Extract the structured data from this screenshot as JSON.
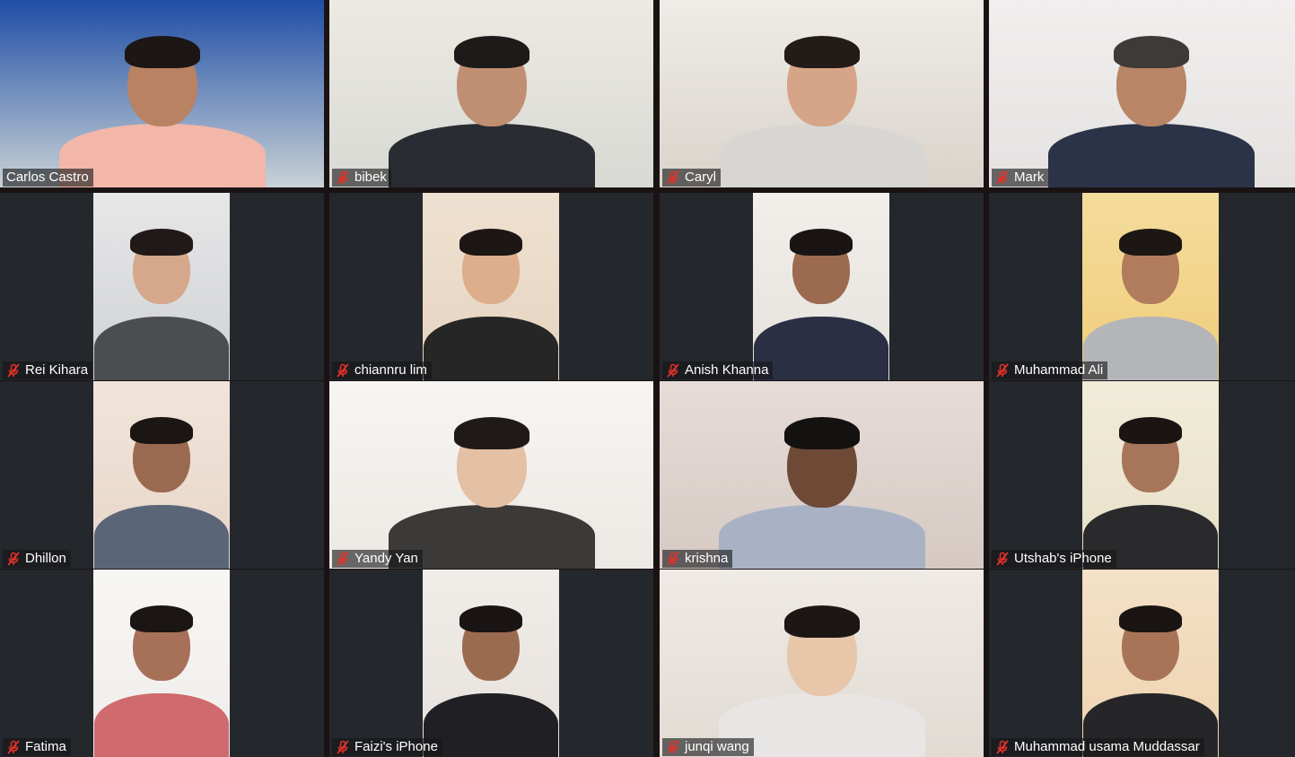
{
  "meeting": {
    "view": "gallery",
    "participants": [
      {
        "name": "Carlos Castro",
        "muted": false,
        "active_speaker": true,
        "video": {
          "layout": "full",
          "bg": "#c9d2d6",
          "wall": "#1f4ea6",
          "skin": "#b98262",
          "hair": "#1c1614",
          "shirt": "#f2b7a8"
        }
      },
      {
        "name": "bibek",
        "muted": true,
        "active_speaker": false,
        "video": {
          "layout": "full",
          "bg": "#d8d9d4",
          "wall": "#eceae2",
          "skin": "#c08f72",
          "hair": "#1d1a1a",
          "shirt": "#2a2c33"
        }
      },
      {
        "name": "Caryl",
        "muted": true,
        "active_speaker": false,
        "video": {
          "layout": "full",
          "bg": "#d9d3cb",
          "wall": "#efece7",
          "skin": "#d6a486",
          "hair": "#231b17",
          "shirt": "#d8d6d2"
        }
      },
      {
        "name": "Mark",
        "muted": true,
        "active_speaker": false,
        "video": {
          "layout": "full",
          "bg": "#e4e2e1",
          "wall": "#f1efee",
          "skin": "#b88566",
          "hair": "#3d3a38",
          "shirt": "#2b3348"
        }
      },
      {
        "name": "Rei Kihara",
        "muted": true,
        "active_speaker": false,
        "video": {
          "layout": "portrait",
          "bg": "#cfd1d4",
          "wall": "#e7e7e8",
          "skin": "#d5a88c",
          "hair": "#201917",
          "shirt": "#4c4d50"
        }
      },
      {
        "name": "chiannru lim",
        "muted": true,
        "active_speaker": false,
        "video": {
          "layout": "portrait",
          "bg": "#e6d3bf",
          "wall": "#efe1d1",
          "skin": "#dcae8c",
          "hair": "#1c1614",
          "shirt": "#262626"
        }
      },
      {
        "name": "Anish Khanna",
        "muted": true,
        "active_speaker": false,
        "video": {
          "layout": "portrait",
          "bg": "#e5e1dc",
          "wall": "#f2efeb",
          "skin": "#9c6a4f",
          "hair": "#1a1514",
          "shirt": "#2a2f44"
        }
      },
      {
        "name": "Muhammad Ali",
        "muted": true,
        "active_speaker": false,
        "video": {
          "layout": "portrait",
          "bg": "#f0ce7a",
          "wall": "#f4dc9c",
          "skin": "#b07c5c",
          "hair": "#1c1715",
          "shirt": "#b3b5b8"
        }
      },
      {
        "name": "Dhillon",
        "muted": true,
        "active_speaker": false,
        "video": {
          "layout": "portrait",
          "bg": "#e8d6c9",
          "wall": "#f0e4da",
          "skin": "#9a6a50",
          "hair": "#1b1613",
          "shirt": "#5a6678"
        }
      },
      {
        "name": "Yandy Yan",
        "muted": true,
        "active_speaker": false,
        "video": {
          "layout": "full",
          "bg": "#ece9e4",
          "wall": "#f7f5f2",
          "skin": "#e4c0a4",
          "hair": "#1f1a18",
          "shirt": "#3c3a38"
        }
      },
      {
        "name": "krishna",
        "muted": true,
        "active_speaker": false,
        "video": {
          "layout": "full",
          "bg": "#d6c9c4",
          "wall": "#e6dcd7",
          "skin": "#6e4a36",
          "hair": "#141111",
          "shirt": "#a9b2c5"
        }
      },
      {
        "name": "Utshab's iPhone",
        "muted": true,
        "active_speaker": false,
        "video": {
          "layout": "portrait",
          "bg": "#e7e0c8",
          "wall": "#f1ecd9",
          "skin": "#a7755a",
          "hair": "#1a1512",
          "shirt": "#2a2a2c"
        }
      },
      {
        "name": "Fatima",
        "muted": true,
        "active_speaker": false,
        "video": {
          "layout": "portrait",
          "bg": "#efedeb",
          "wall": "#f7f6f4",
          "skin": "#a77058",
          "hair": "#1b1513",
          "shirt": "#cf6a6e"
        }
      },
      {
        "name": "Faizi's iPhone",
        "muted": true,
        "active_speaker": false,
        "video": {
          "layout": "portrait",
          "bg": "#e6e1dc",
          "wall": "#f0ece8",
          "skin": "#9b6b50",
          "hair": "#1a1514",
          "shirt": "#202024"
        }
      },
      {
        "name": "junqi wang",
        "muted": true,
        "active_speaker": false,
        "video": {
          "layout": "full",
          "bg": "#e1dbd4",
          "wall": "#efeae5",
          "skin": "#e7c6aa",
          "hair": "#1c1715",
          "shirt": "#e8e6e4"
        }
      },
      {
        "name": "Muhammad usama Muddassar",
        "muted": true,
        "active_speaker": false,
        "video": {
          "layout": "portrait",
          "bg": "#eed3b0",
          "wall": "#f4e1c7",
          "skin": "#a87458",
          "hair": "#1a1513",
          "shirt": "#262628"
        }
      }
    ]
  },
  "colors": {
    "background": "#1a1213",
    "tile_empty": "#24272b",
    "active_speaker_border": "#e3e67a",
    "muted_icon": "#e0322a",
    "name_text": "#ffffff"
  },
  "icons": {
    "muted": "microphone-muted-icon"
  }
}
